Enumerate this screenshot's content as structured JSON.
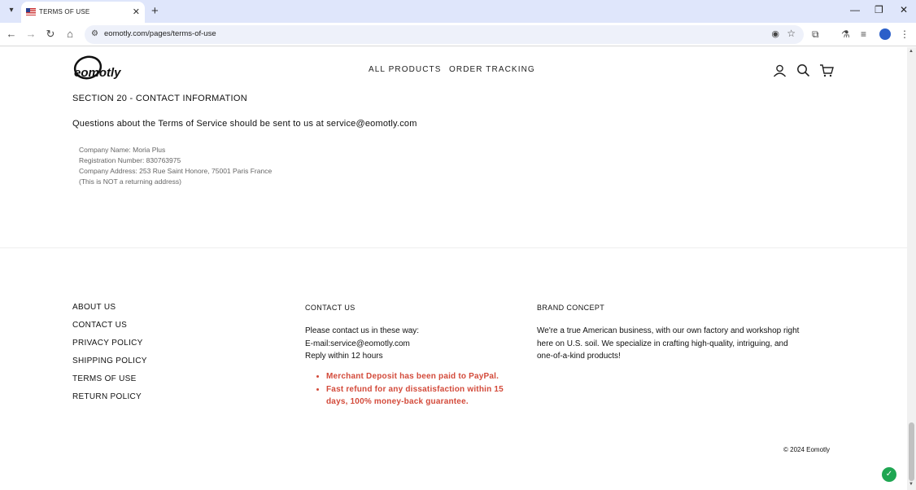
{
  "browser": {
    "tab_title": "TERMS OF USE",
    "url": "eomotly.com/pages/terms-of-use"
  },
  "site": {
    "logo_text": "eomotly",
    "nav": [
      "ALL PRODUCTS",
      "ORDER TRACKING"
    ]
  },
  "content": {
    "section_title": "SECTION 20 - CONTACT INFORMATION",
    "questions": "Questions about the Terms of Service should be sent to us at service@eomotly.com",
    "company_lines": [
      "Company Name: Moria Plus",
      "Registration Number: 830763975",
      "Company Address: 253 Rue Saint Honore, 75001 Paris France",
      "(This is NOT a returning address)"
    ]
  },
  "footer": {
    "links": [
      "ABOUT US",
      "CONTACT US",
      "PRIVACY POLICY",
      "SHIPPING POLICY",
      "TERMS OF USE",
      "RETURN POLICY"
    ],
    "contact_heading": "CONTACT US",
    "contact_lines": [
      "Please contact us in these way:",
      "E-mail:service@eomotly.com",
      "Reply within 12 hours"
    ],
    "promo_items": [
      "Merchant Deposit has been paid to PayPal.",
      "Fast refund for any dissatisfaction within 15 days, 100% money-back guarantee."
    ],
    "brand_heading": "BRAND CONCEPT",
    "brand_text": "We're a true American business, with our own factory and workshop right here on U.S. soil. We specialize in crafting high-quality, intriguing, and one-of-a-kind products!",
    "copyright": "© 2024 Eomotly"
  },
  "colors": {
    "promo": "#d34a3a",
    "tabbar": "#dfe6fb",
    "chat": "#1fa652"
  },
  "icons": [
    "account-icon",
    "search-icon",
    "cart-icon"
  ]
}
